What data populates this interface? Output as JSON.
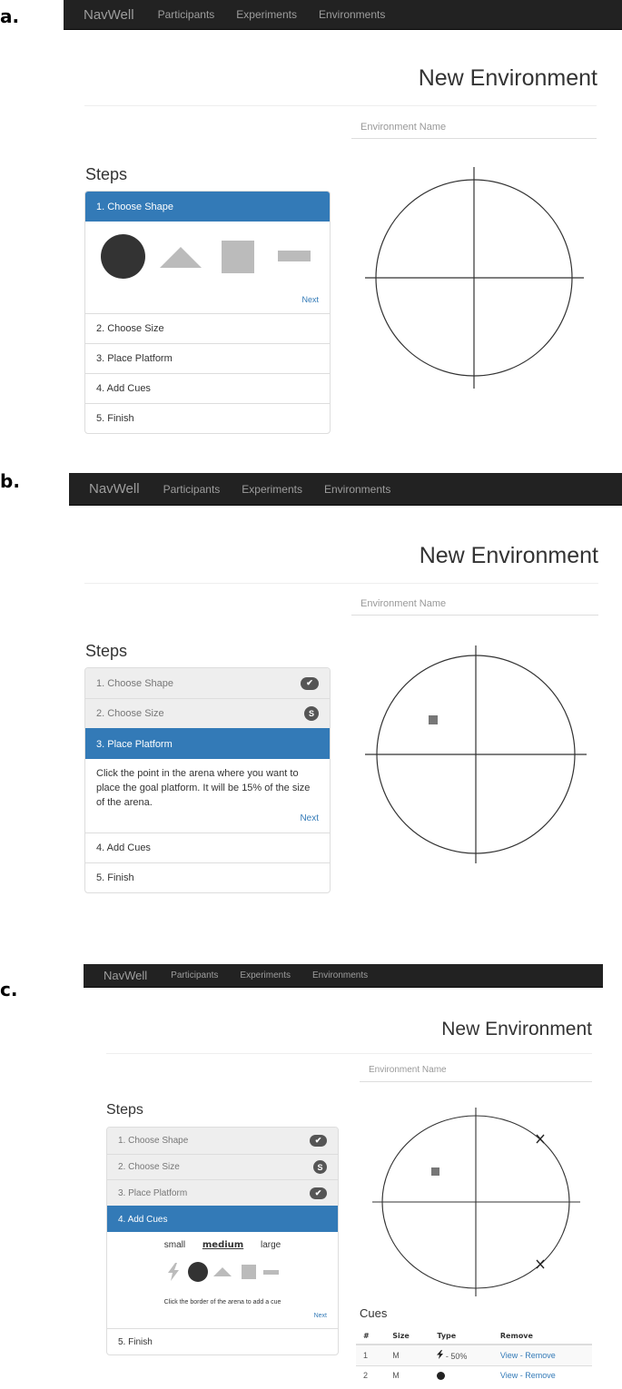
{
  "panels": [
    {
      "label": "a."
    },
    {
      "label": "b."
    },
    {
      "label": "c."
    }
  ],
  "navbar": {
    "brand": "NavWell",
    "links": [
      "Participants",
      "Experiments",
      "Environments"
    ]
  },
  "page_title": "New Environment",
  "env_name_placeholder": "Environment Name",
  "steps_title": "Steps",
  "steps": [
    "1. Choose Shape",
    "2. Choose Size",
    "3. Place Platform",
    "4. Add Cues",
    "5. Finish"
  ],
  "next_label": "Next",
  "badges": {
    "check": "✔",
    "size": "S"
  },
  "platform_instruction": "Click the point in the arena where you want to place the goal platform. It will be 15% of the size of the arena.",
  "cue_sizes": {
    "small": "small",
    "medium": "medium",
    "large": "large",
    "selected": "medium"
  },
  "cue_instruction": "Click the border of the arena to add a cue",
  "cues": {
    "title": "Cues",
    "columns": [
      "#",
      "Size",
      "Type",
      "Remove"
    ],
    "rows": [
      {
        "num": "1",
        "size": "M",
        "type_icon": "lightning-icon",
        "type_text": "- 50%",
        "view": "View",
        "sep": " - ",
        "remove": "Remove"
      },
      {
        "num": "2",
        "size": "M",
        "type_icon": "circle-icon",
        "type_text": "",
        "view": "View",
        "sep": " - ",
        "remove": "Remove"
      }
    ]
  },
  "colors": {
    "active": "#337ab7",
    "navbar": "#222222",
    "badge": "#555555",
    "shape_selected": "#333333",
    "shape_unselected": "#bbbbbb"
  }
}
